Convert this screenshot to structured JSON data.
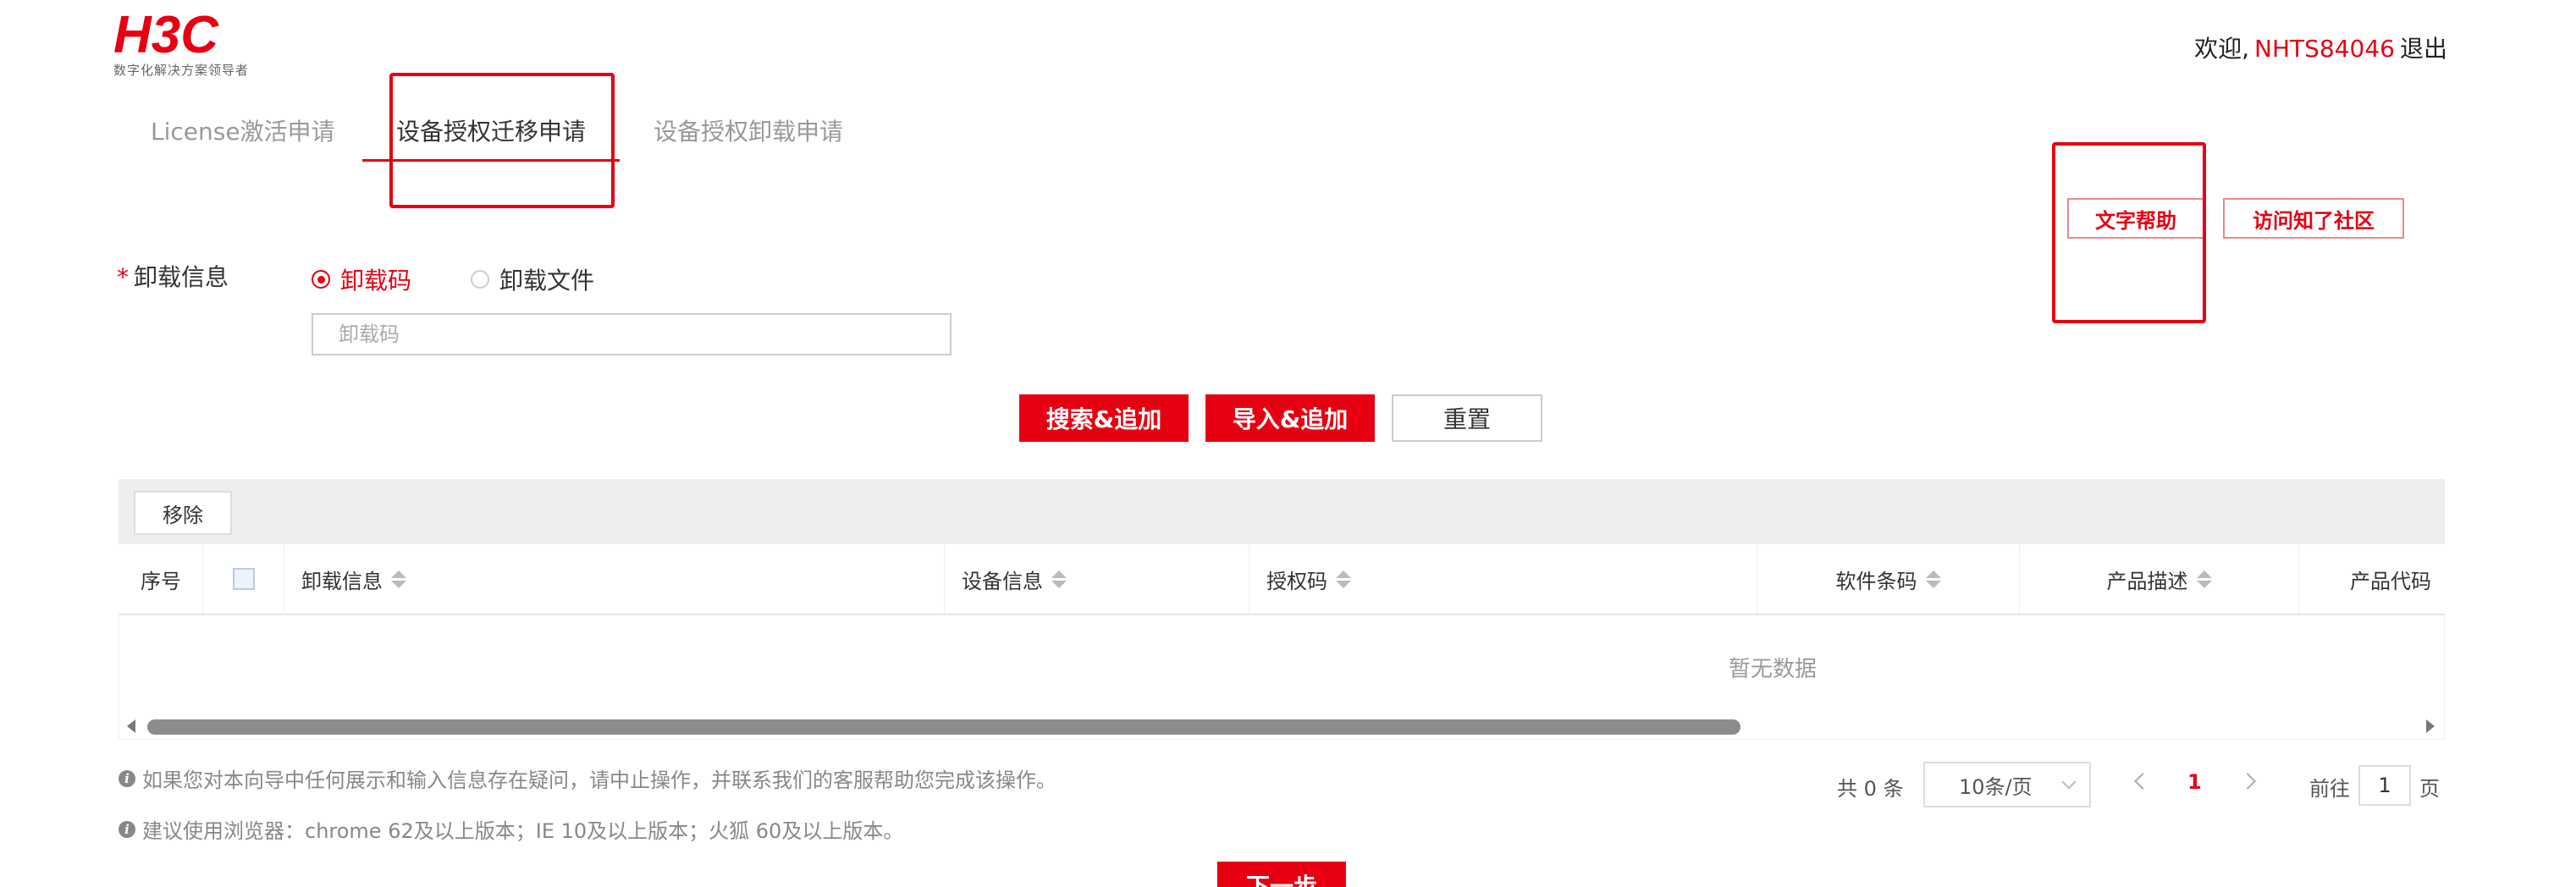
{
  "header": {
    "logo_text": "H3C",
    "tagline": "数字化解决方案领导者",
    "welcome_prefix": "欢迎,",
    "username": "NHTS84046",
    "logout": "退出"
  },
  "tabs": [
    {
      "label": "License激活申请"
    },
    {
      "label": "设备授权迁移申请"
    },
    {
      "label": "设备授权卸载申请"
    }
  ],
  "help": {
    "text_help": "文字帮助",
    "community": "访问知了社区"
  },
  "form": {
    "required_mark": "*",
    "label": "卸载信息",
    "radio_code": "卸载码",
    "radio_file": "卸载文件",
    "input_placeholder": "卸载码",
    "input_value": ""
  },
  "actions": {
    "search_add": "搜索&追加",
    "import_add": "导入&追加",
    "reset": "重置"
  },
  "table": {
    "remove": "移除",
    "columns": [
      "序号",
      "卸载信息",
      "设备信息",
      "授权码",
      "软件条码",
      "产品描述",
      "产品代码"
    ],
    "empty_text": "暂无数据"
  },
  "notes": {
    "note1": "如果您对本向导中任何展示和输入信息存在疑问，请中止操作，并联系我们的客服帮助您完成该操作。",
    "note2": "建议使用浏览器：chrome 62及以上版本；IE 10及以上版本；火狐 60及以上版本。"
  },
  "pagination": {
    "total": "共 0 条",
    "page_size": "10条/页",
    "current_page": "1",
    "goto_label": "前往",
    "goto_value": "1",
    "page_unit": "页"
  },
  "next_button": "下一步",
  "colors": {
    "brand_red": "#e60012",
    "muted_text": "#999999"
  },
  "icons": [
    "h3c-logo",
    "sort-icon",
    "info-icon",
    "chevron-down-icon",
    "chevron-left-icon",
    "chevron-right-icon"
  ]
}
